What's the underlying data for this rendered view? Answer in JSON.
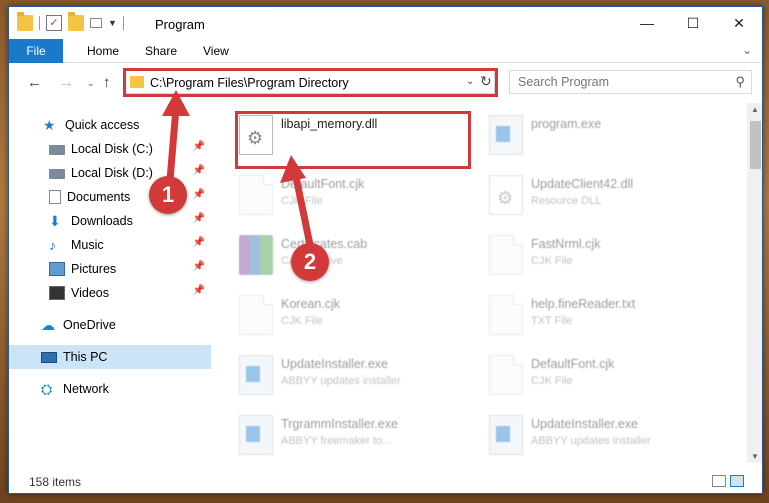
{
  "window": {
    "title": "Program",
    "quick_access_icons": [
      "folder-icon",
      "properties-icon",
      "new-folder-icon",
      "customize-icon"
    ]
  },
  "window_controls": {
    "minimize": "—",
    "maximize": "☐",
    "close": "✕"
  },
  "ribbon": {
    "tabs": [
      "File",
      "Home",
      "Share",
      "View"
    ],
    "expand_glyph": "⌄"
  },
  "address": {
    "path": "C:\\Program Files\\Program Directory",
    "back_glyph": "←",
    "forward_glyph": "→",
    "recent_glyph": "⌄",
    "up_glyph": "↑",
    "dropdown_glyph": "⌄",
    "refresh_glyph": "↻"
  },
  "search": {
    "placeholder": "Search Program",
    "icon_glyph": "⚲"
  },
  "sidebar": {
    "items": [
      {
        "label": "Quick access",
        "icon": "star-icon",
        "pinned": false
      },
      {
        "label": "Local Disk (C:)",
        "icon": "disk-icon",
        "pinned": true
      },
      {
        "label": "Local Disk (D:)",
        "icon": "disk-icon",
        "pinned": true
      },
      {
        "label": "Documents",
        "icon": "documents-icon",
        "pinned": true
      },
      {
        "label": "Downloads",
        "icon": "downloads-icon",
        "pinned": true
      },
      {
        "label": "Music",
        "icon": "music-icon",
        "pinned": true
      },
      {
        "label": "Pictures",
        "icon": "pictures-icon",
        "pinned": true
      },
      {
        "label": "Videos",
        "icon": "videos-icon",
        "pinned": true
      },
      {
        "label": "OneDrive",
        "icon": "onedrive-icon",
        "pinned": false
      },
      {
        "label": "This PC",
        "icon": "this-pc-icon",
        "pinned": false,
        "selected": true
      },
      {
        "label": "Network",
        "icon": "network-icon",
        "pinned": false
      }
    ],
    "pin_glyph": "📌"
  },
  "files": [
    {
      "name": "libapi_memory.dll",
      "type": "",
      "icon": "dll-gear-icon",
      "highlighted": true
    },
    {
      "name": "program.exe",
      "type": "",
      "icon": "application-icon",
      "highlighted": false
    },
    {
      "name": "DefaultFont.cjk",
      "type": "CJK File",
      "icon": "file-icon",
      "highlighted": false
    },
    {
      "name": "UpdateClient42.dll",
      "type": "Resource DLL",
      "icon": "dll-gear-icon",
      "highlighted": false
    },
    {
      "name": "Certificates.cab",
      "type": "CAB Archive",
      "icon": "archive-icon",
      "highlighted": false
    },
    {
      "name": "FastNrml.cjk",
      "type": "CJK File",
      "icon": "file-icon",
      "highlighted": false
    },
    {
      "name": "Korean.cjk",
      "type": "CJK File",
      "icon": "file-icon",
      "highlighted": false
    },
    {
      "name": "help.fineReader.txt",
      "type": "TXT File",
      "icon": "file-icon",
      "highlighted": false
    },
    {
      "name": "UpdateInstaller.exe",
      "type": "ABBYY updates installer",
      "icon": "application-icon",
      "highlighted": false
    },
    {
      "name": "DefaultFont.cjk",
      "type": "CJK File",
      "icon": "file-icon",
      "highlighted": false
    },
    {
      "name": "TrgrammInstaller.exe",
      "type": "ABBYY freemaker to...",
      "icon": "application-icon",
      "highlighted": false
    },
    {
      "name": "UpdateInstaller.exe",
      "type": "ABBYY updates installer",
      "icon": "application-icon",
      "highlighted": false
    }
  ],
  "status": {
    "item_count": "158 items"
  },
  "annotations": {
    "callout_1": "1",
    "callout_2": "2",
    "accent_color": "#d23a3a"
  },
  "colors": {
    "file_tab": "#1979ca",
    "selection": "#cce4f7"
  }
}
